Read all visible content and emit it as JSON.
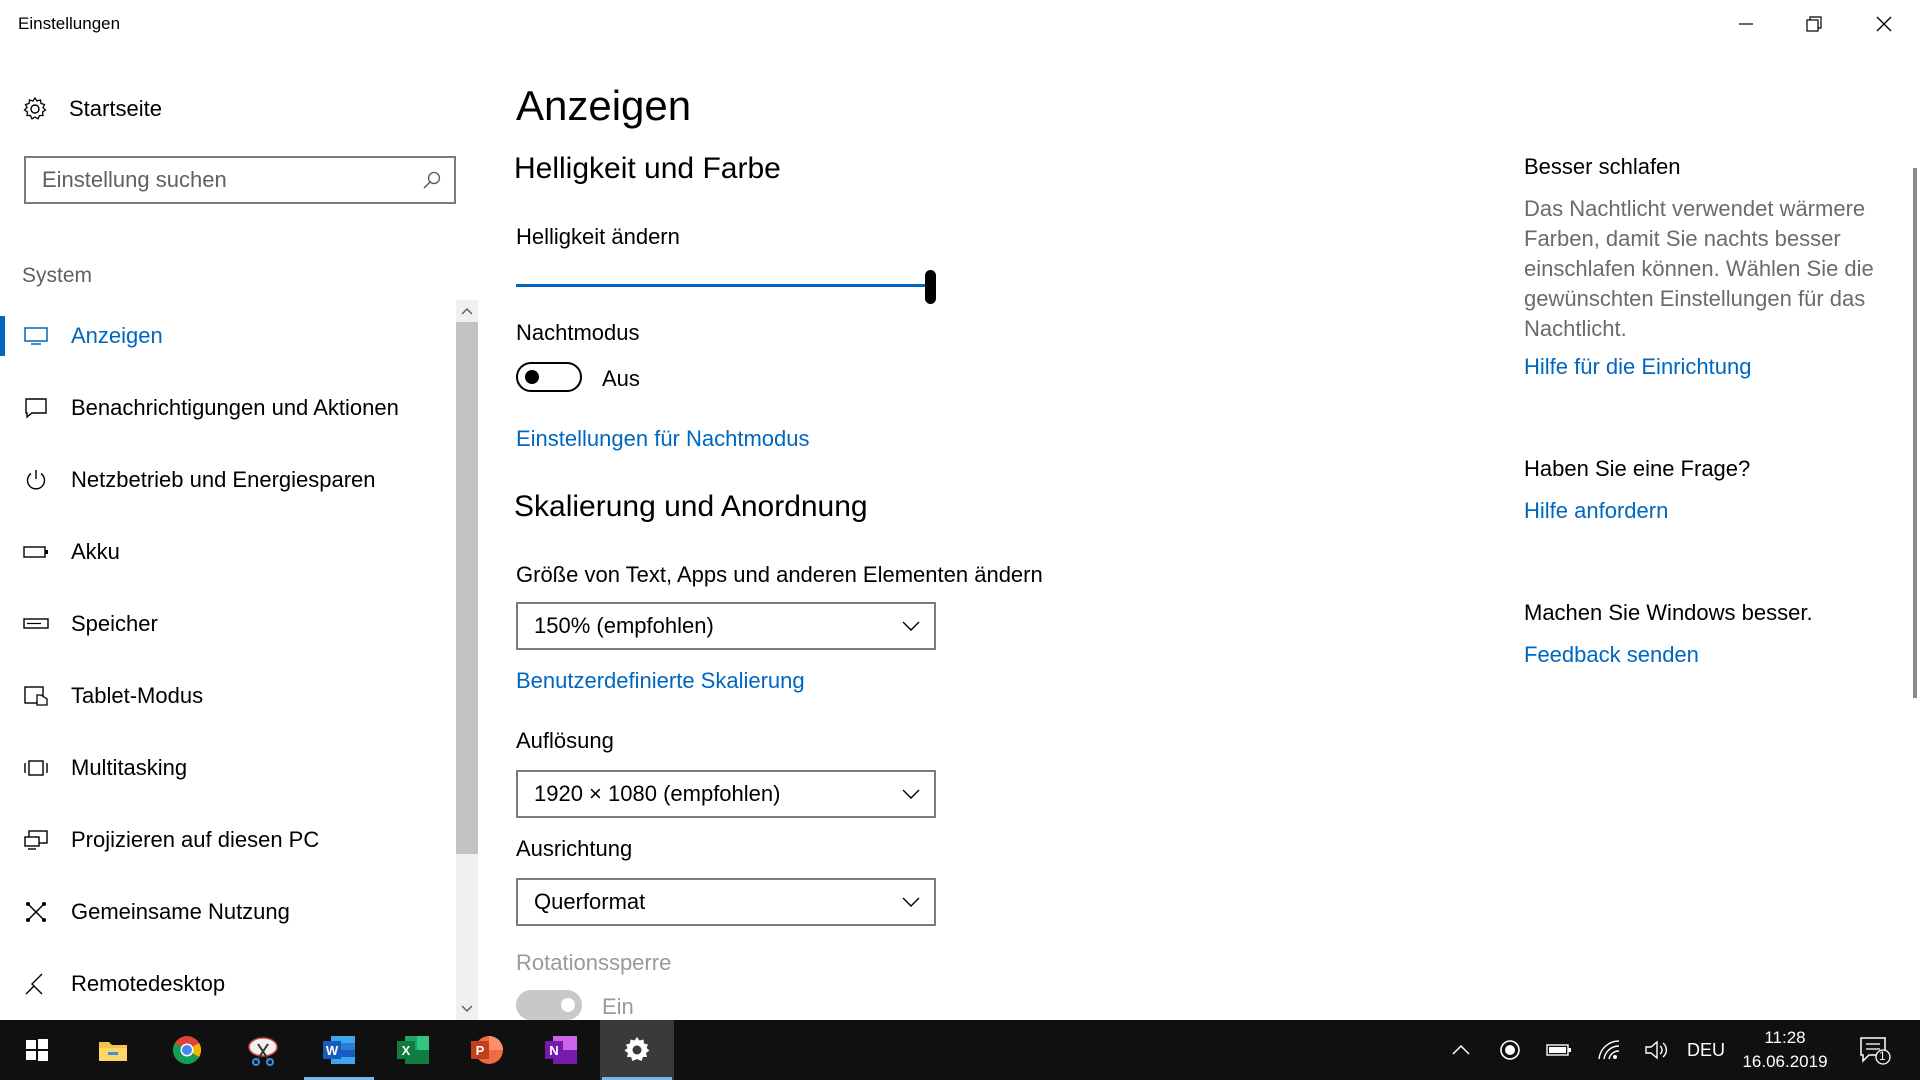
{
  "window": {
    "title": "Einstellungen",
    "minimize_icon": "minimize-icon",
    "restore_icon": "restore-icon",
    "close_icon": "close-icon"
  },
  "sidebar": {
    "home_label": "Startseite",
    "search_placeholder": "Einstellung suchen",
    "section_label": "System",
    "items": [
      {
        "label": "Anzeigen",
        "icon": "monitor-icon",
        "active": true
      },
      {
        "label": "Benachrichtigungen und Aktionen",
        "icon": "message-icon",
        "active": false
      },
      {
        "label": "Netzbetrieb und Energiesparen",
        "icon": "power-icon",
        "active": false
      },
      {
        "label": "Akku",
        "icon": "battery-icon",
        "active": false
      },
      {
        "label": "Speicher",
        "icon": "storage-icon",
        "active": false
      },
      {
        "label": "Tablet-Modus",
        "icon": "tablet-mode-icon",
        "active": false
      },
      {
        "label": "Multitasking",
        "icon": "multitasking-icon",
        "active": false
      },
      {
        "label": "Projizieren auf diesen PC",
        "icon": "project-icon",
        "active": false
      },
      {
        "label": "Gemeinsame Nutzung",
        "icon": "share-icon",
        "active": false
      },
      {
        "label": "Remotedesktop",
        "icon": "remote-desktop-icon",
        "active": false
      }
    ]
  },
  "main": {
    "title": "Anzeigen",
    "brightness_section": "Helligkeit und Farbe",
    "brightness_label": "Helligkeit ändern",
    "brightness_value": 100,
    "night_mode_label": "Nachtmodus",
    "night_mode_state": "Aus",
    "night_mode_settings_link": "Einstellungen für Nachtmodus",
    "scaling_section": "Skalierung und Anordnung",
    "scale_label": "Größe von Text, Apps und anderen Elementen ändern",
    "scale_value": "150% (empfohlen)",
    "custom_scaling_link": "Benutzerdefinierte Skalierung",
    "resolution_label": "Auflösung",
    "resolution_value": "1920 × 1080 (empfohlen)",
    "orientation_label": "Ausrichtung",
    "orientation_value": "Querformat",
    "rotation_lock_label": "Rotationssperre",
    "rotation_lock_state": "Ein"
  },
  "right": {
    "sleep_heading": "Besser schlafen",
    "sleep_text": "Das Nachtlicht verwendet wärmere Farben, damit Sie nachts besser einschlafen können. Wählen Sie die gewünschten Einstellungen für das Nachtlicht.",
    "setup_help_link": "Hilfe für die Einrichtung",
    "question_heading": "Haben Sie eine Frage?",
    "get_help_link": "Hilfe anfordern",
    "improve_heading": "Machen Sie Windows besser.",
    "feedback_link": "Feedback senden"
  },
  "taskbar": {
    "apps": [
      "start-icon",
      "file-explorer-icon",
      "chrome-icon",
      "snipping-tool-icon",
      "word-icon",
      "excel-icon",
      "powerpoint-icon",
      "onenote-icon",
      "settings-icon"
    ],
    "language": "DEU",
    "time": "11:28",
    "date": "16.06.2019",
    "notification_count": "1"
  },
  "colors": {
    "accent": "#0067c0",
    "taskbar": "#101010"
  }
}
